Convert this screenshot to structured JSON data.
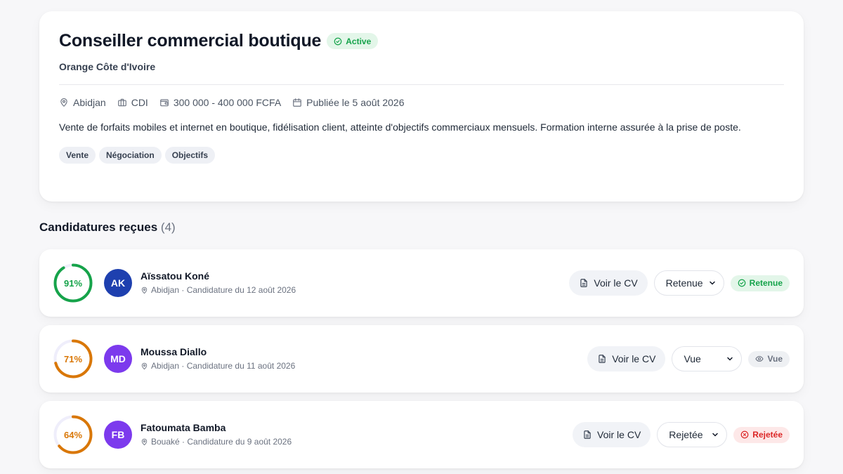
{
  "job": {
    "title": "Conseiller commercial boutique",
    "status": "Active",
    "company": "Orange Côte d'Ivoire",
    "location": "Abidjan",
    "contract": "CDI",
    "salary": "300 000 - 400 000 FCFA",
    "published": "Publiée le 5 août 2026",
    "description": "Vente de forfaits mobiles et internet en boutique, fidélisation client, atteinte d'objectifs commerciaux mensuels. Formation interne assurée à la prise de poste.",
    "tags": [
      "Vente",
      "Négociation",
      "Objectifs"
    ]
  },
  "applications": {
    "title": "Candidatures reçues",
    "count": "(4)",
    "cv_label": "Voir le CV",
    "items": [
      {
        "score": 91,
        "score_label": "91%",
        "score_color": "#16a34a",
        "initials": "AK",
        "avatar_color": "#1e40af",
        "name": "Aïssatou Koné",
        "details": "Abidjan · Candidature du 12 août 2026",
        "select_value": "Retenue",
        "status": "Retenue"
      },
      {
        "score": 71,
        "score_label": "71%",
        "score_color": "#d97706",
        "initials": "MD",
        "avatar_color": "#7c3aed",
        "name": "Moussa Diallo",
        "details": "Abidjan · Candidature du 11 août 2026",
        "select_value": "Vue",
        "status": "Vue"
      },
      {
        "score": 64,
        "score_label": "64%",
        "score_color": "#d97706",
        "initials": "FB",
        "avatar_color": "#7c3aed",
        "name": "Fatoumata Bamba",
        "details": "Bouaké · Candidature du 9 août 2026",
        "select_value": "Rejetée",
        "status": "Rejetée"
      }
    ]
  }
}
